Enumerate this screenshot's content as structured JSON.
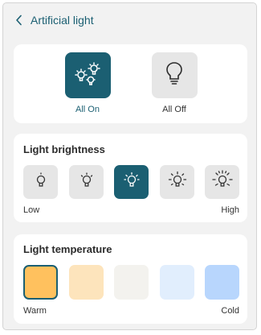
{
  "header": {
    "title": "Artificial light",
    "back_icon": "chevron-left-icon"
  },
  "all_controls": {
    "all_on": {
      "label": "All On",
      "icon": "multi-bulb-icon",
      "selected": true
    },
    "all_off": {
      "label": "All Off",
      "icon": "bulb-off-icon",
      "selected": false
    }
  },
  "brightness": {
    "title": "Light brightness",
    "low_label": "Low",
    "high_label": "High",
    "levels": [
      1,
      2,
      3,
      4,
      5
    ],
    "selected_level": 3
  },
  "temperature": {
    "title": "Light temperature",
    "warm_label": "Warm",
    "cold_label": "Cold",
    "swatches": [
      "#ffc15e",
      "#fde4bc",
      "#f3f2ee",
      "#e1eefd",
      "#b8d6fd"
    ],
    "selected_index": 0
  },
  "colors": {
    "accent": "#1b5f72",
    "tile": "#e6e6e6",
    "card": "#ffffff",
    "background": "#f2f2f2"
  }
}
